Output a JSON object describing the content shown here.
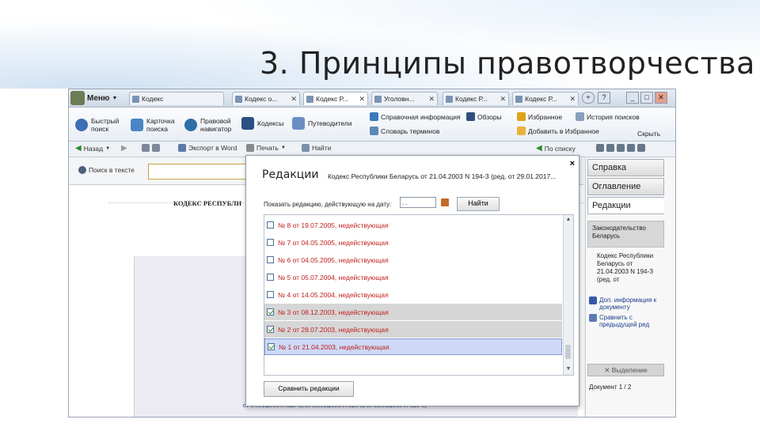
{
  "slide": {
    "title": "3. Принципы правотворчества"
  },
  "app": {
    "menu_label": "Меню",
    "tabs": [
      {
        "label": "Кодекс"
      },
      {
        "label": "Кодекс о..."
      },
      {
        "label": "Кодекс Р..."
      },
      {
        "label": "Уголовн..."
      },
      {
        "label": "Кодекс Р..."
      },
      {
        "label": "Кодекс Р..."
      }
    ],
    "ribbon": {
      "quick_search": "Быстрый\nпоиск",
      "search_card": "Карточка\nпоиска",
      "legal_navigator": "Правовой\nнавигатор",
      "codes": "Кодексы",
      "guides": "Путеводители",
      "reference_info": "Справочная информация",
      "reviews": "Обзоры",
      "dictionary": "Словарь терминов",
      "favorites": "Избранное",
      "search_history": "История поисков",
      "add_favorites": "Добавить в Избранное",
      "hide": "Скрыть"
    },
    "nav": {
      "back": "Назад",
      "export_word": "Экспорт в Word",
      "print": "Печать",
      "find": "Найти",
      "search": "По списку"
    },
    "search": {
      "label": "Поиск в тексте"
    },
    "document": {
      "title": "КОДЕКС РЕСПУБЛИ",
      "bottom_text": "от 04.01.2008 N 329-З, от 05.01.2008 N 320-З, от 05.01.2008 N 321-З,"
    },
    "sidebar": {
      "tabs": [
        "Справка",
        "Оглавление",
        "Редакции"
      ],
      "legislation": "Законодательство Беларусь",
      "doc_desc": "Кодекс Республики Беларусь от 21.04.2003 N 194-З (ред. от",
      "doc_info": "Доп. информация к документу",
      "compare_prev": "Сравнить с предыдущей ред",
      "highlight": "Выделение",
      "documents_label": "Документ",
      "documents_count": "1 / 2"
    },
    "dialog": {
      "title": "Редакции",
      "subtitle": "Кодекс Республики Беларусь от 21.04.2003 N 194-З (ред. от 29.01.2017...",
      "close": "×",
      "show_label": "Показать редакцию, действующую на дату:",
      "date_value": ".  .",
      "find_button": "Найти",
      "compare_button": "Сравнить редакции",
      "items": [
        {
          "label": "№ 8 от 19.07.2005, недействующая",
          "checked": false,
          "state": "normal"
        },
        {
          "label": "№ 7 от 04.05.2005, недействующая",
          "checked": false,
          "state": "normal"
        },
        {
          "label": "№ 6 от 04.05.2005, недействующая",
          "checked": false,
          "state": "normal"
        },
        {
          "label": "№ 5 от 05.07.2004, недействующая",
          "checked": false,
          "state": "normal"
        },
        {
          "label": "№ 4 от 14.05.2004, недействующая",
          "checked": false,
          "state": "normal"
        },
        {
          "label": "№ 3 от 08.12.2003, недействующая",
          "checked": true,
          "state": "gray"
        },
        {
          "label": "№ 2 от 28.07.2003, недействующая",
          "checked": true,
          "state": "gray"
        },
        {
          "label": "№ 1 от 21.04.2003, недействующая",
          "checked": true,
          "state": "selected"
        }
      ]
    }
  }
}
